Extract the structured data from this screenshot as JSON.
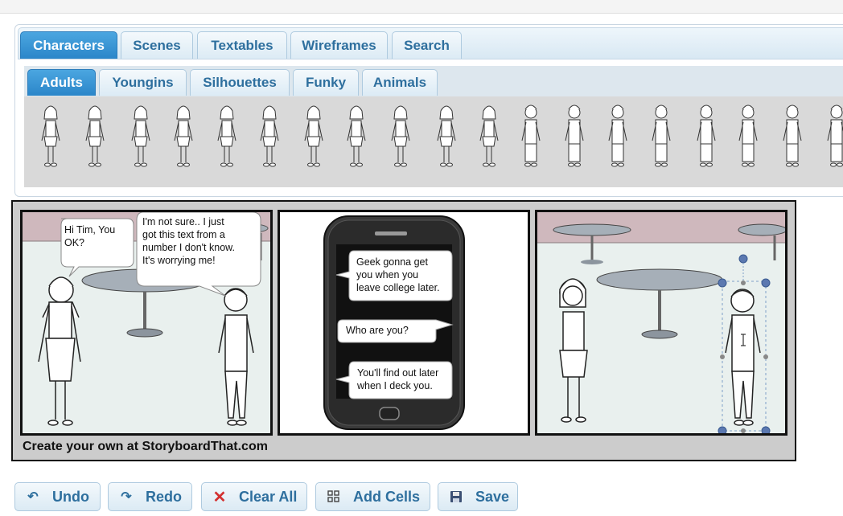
{
  "main_tabs": [
    {
      "label": "Characters",
      "active": true
    },
    {
      "label": "Scenes",
      "active": false
    },
    {
      "label": "Textables",
      "active": false
    },
    {
      "label": "Wireframes",
      "active": false
    },
    {
      "label": "Search",
      "active": false
    }
  ],
  "sub_tabs": [
    {
      "label": "Adults",
      "active": true
    },
    {
      "label": "Youngins",
      "active": false
    },
    {
      "label": "Silhouettes",
      "active": false
    },
    {
      "label": "Funky",
      "active": false
    },
    {
      "label": "Animals",
      "active": false
    }
  ],
  "palette_icon": "stick-figure-character-icon",
  "storyboard": {
    "credit": "Create your own at StoryboardThat.com",
    "panel1": {
      "bubble_left": [
        "Hi Tim, You",
        "OK?"
      ],
      "bubble_right": [
        "I'm not sure.. I just",
        "got this text from a",
        "number I don't know.",
        "It's worrying me!"
      ]
    },
    "panel2": {
      "message1": [
        "Geek gonna get",
        "you when you",
        "leave college later."
      ],
      "message2": [
        "Who are you?"
      ],
      "message3": [
        "You'll find out later",
        "when I deck you."
      ]
    }
  },
  "toolbar": {
    "undo": "Undo",
    "redo": "Redo",
    "clear_all": "Clear All",
    "add_cells": "Add Cells",
    "save": "Save"
  },
  "colors": {
    "tab_active": "#3396d6",
    "tab_text": "#2e6f9e",
    "panel_wall": "#e9f0ee",
    "panel_top_wall": "#cfb8bd",
    "table": "#a6afb8",
    "clear_all_icon": "#d33030"
  }
}
